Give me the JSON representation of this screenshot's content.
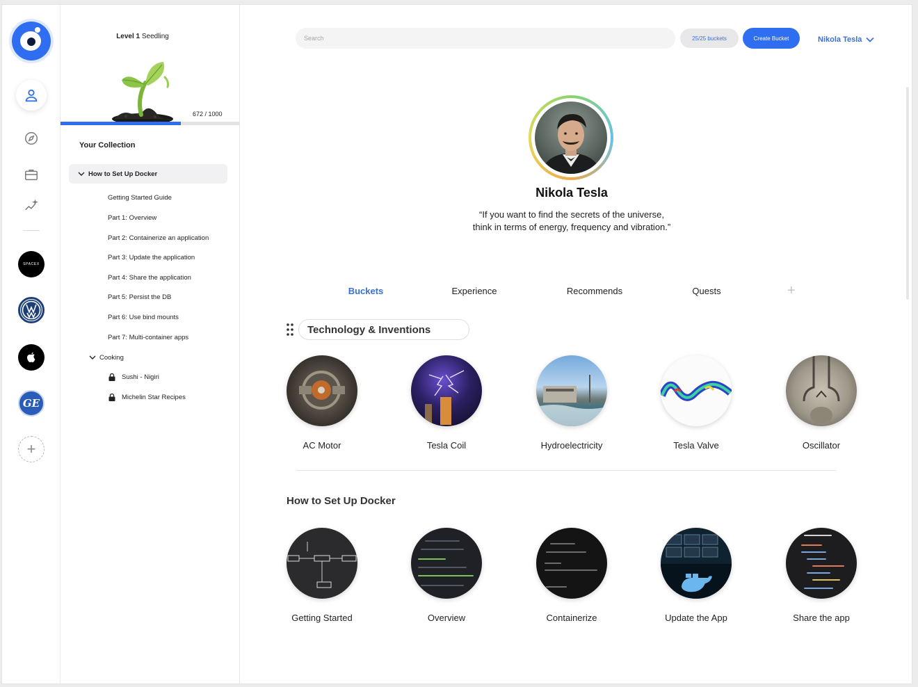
{
  "sidebar": {
    "brands": [
      "SPACEX"
    ],
    "ge_label": "GE"
  },
  "collection_panel": {
    "level_label": "Level 1",
    "level_name": "Seedling",
    "progress_text": "672 / 1000",
    "progress_fraction": 0.672,
    "title": "Your Collection",
    "groups": [
      {
        "label": "How to Set Up Docker",
        "items": [
          "Getting Started Guide",
          "Part 1: Overview",
          "Part 2: Containerize an application",
          "Part 3: Update the application",
          "Part 4: Share the application",
          "Part 5: Persist the DB",
          "Part 6: Use bind mounts",
          "Part 7: Multi-container apps"
        ]
      },
      {
        "label": "Cooking",
        "items": [
          "Sushi - Nigiri",
          "Michelin Star Recipes"
        ]
      }
    ]
  },
  "header": {
    "search_placeholder": "Search",
    "bucket_count": "25/25 buckets",
    "create_button": "Create Bucket",
    "user_name": "Nikola Tesla"
  },
  "profile": {
    "name": "Nikola Tesla",
    "quote_line1": "“If you want to find the secrets of the universe,",
    "quote_line2": "think in terms of energy, frequency and vibration.”"
  },
  "tabs": [
    "Buckets",
    "Experience",
    "Recommends",
    "Quests"
  ],
  "active_tab": "Buckets",
  "sections": [
    {
      "title": "Technology & Inventions",
      "items": [
        "AC Motor",
        "Tesla Coil",
        "Hydroelectricity",
        "Tesla Valve",
        "Oscillator"
      ]
    },
    {
      "title": "How to Set Up Docker",
      "items": [
        "Getting Started",
        "Overview",
        "Containerize",
        "Update the App",
        "Share the app"
      ]
    }
  ],
  "colors": {
    "accent": "#2f6ef0",
    "link": "#3a6fd9",
    "page_bg": "#ffffff"
  }
}
